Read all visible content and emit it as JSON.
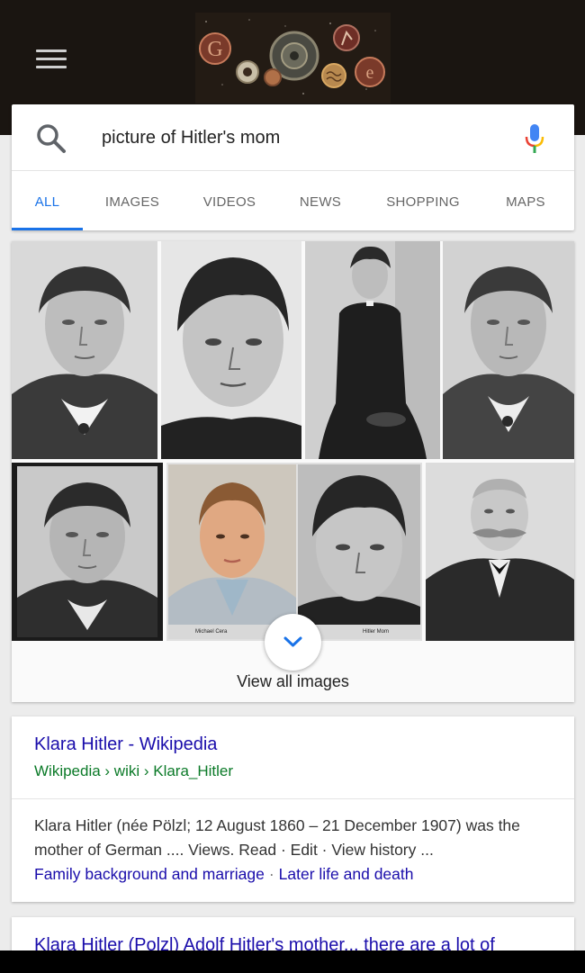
{
  "header": {
    "menu_icon": "hamburger-menu-icon",
    "doodle_icon": "google-doodle-logo"
  },
  "search": {
    "query": "picture of Hitler's mom",
    "search_icon": "search-icon",
    "mic_icon": "microphone-icon"
  },
  "tabs": [
    {
      "label": "ALL",
      "active": true
    },
    {
      "label": "IMAGES",
      "active": false
    },
    {
      "label": "VIDEOS",
      "active": false
    },
    {
      "label": "NEWS",
      "active": false
    },
    {
      "label": "SHOPPING",
      "active": false
    },
    {
      "label": "MAPS",
      "active": false
    }
  ],
  "images": {
    "captions": {
      "left": "Michael Cera",
      "right": "Hitler Mom"
    },
    "view_all_label": "View all images",
    "expand_icon": "chevron-down-icon"
  },
  "results": [
    {
      "title": "Klara Hitler - Wikipedia",
      "url": "Wikipedia › wiki › Klara_Hitler",
      "snippet": "Klara Hitler (née Pölzl; 12 August 1860 – 21 December 1907) was the mother of German .... Views. Read · Edit · View history ...",
      "sitelinks": [
        "Family background and marriage",
        "Later life and death"
      ]
    },
    {
      "title": "Klara Hitler (Polzl) Adolf Hitler's mother... there are a lot of"
    }
  ],
  "colors": {
    "accent": "#1a73e8",
    "link": "#1a0dab",
    "url_green": "#0b7a28",
    "header_bg": "#1a1511"
  }
}
